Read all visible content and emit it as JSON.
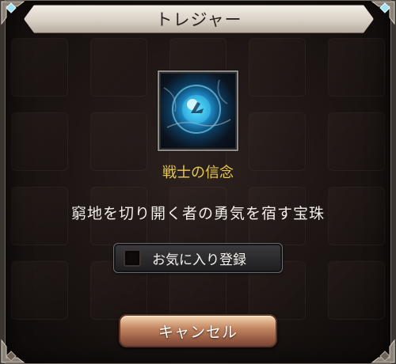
{
  "dialog": {
    "title": "トレジャー"
  },
  "item": {
    "icon": "blue-orb-icon",
    "name": "戦士の信念",
    "description": "窮地を切り開く者の勇気を宿す宝珠"
  },
  "favorite": {
    "label": "お気に入り登録",
    "checked": false
  },
  "actions": {
    "cancel_label": "キャンセル"
  },
  "colors": {
    "item_name": "#e7c94f",
    "cancel_button": "#b97a58",
    "title_bar": "#e4ddd3"
  }
}
